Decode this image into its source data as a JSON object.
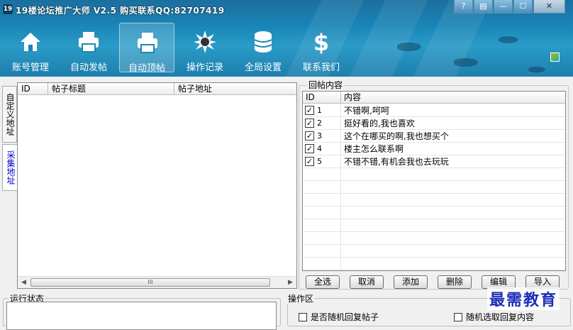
{
  "window": {
    "title": "19楼论坛推广大师 V2.5 购买联系QQ:82707419",
    "logo_glyph": "19"
  },
  "toolbar": {
    "items": [
      {
        "label": "账号管理",
        "icon": "home-icon"
      },
      {
        "label": "自动发帖",
        "icon": "printer-icon"
      },
      {
        "label": "自动顶帖",
        "icon": "printer-icon",
        "active": true
      },
      {
        "label": "操作记录",
        "icon": "starburst-icon"
      },
      {
        "label": "全局设置",
        "icon": "database-icon"
      },
      {
        "label": "联系我们",
        "icon": "dollar-icon"
      }
    ]
  },
  "side_tabs": [
    "自定义地址",
    "采集地址"
  ],
  "post_list": {
    "columns": [
      "ID",
      "帖子标题",
      "帖子地址"
    ],
    "scroll_glyph": "III"
  },
  "reply": {
    "group_label": "回帖内容",
    "columns": [
      "ID",
      "内容"
    ],
    "rows": [
      {
        "id": "1",
        "text": "不错啊,呵呵",
        "checked": true
      },
      {
        "id": "2",
        "text": "挺好看的,我也喜欢",
        "checked": true
      },
      {
        "id": "3",
        "text": "这个在哪买的啊,我也想买个",
        "checked": true
      },
      {
        "id": "4",
        "text": "楼主怎么联系啊",
        "checked": true
      },
      {
        "id": "5",
        "text": "不错不错,有机会我也去玩玩",
        "checked": true
      }
    ],
    "buttons": [
      "全选",
      "取消",
      "添加",
      "删除",
      "编辑",
      "导入"
    ]
  },
  "status": {
    "label": "运行状态"
  },
  "operation": {
    "label": "操作区",
    "options": [
      "是否随机回复帖子",
      "随机选取回复内容"
    ]
  },
  "watermark": "最需教育",
  "colors": {
    "header_blue": "#1a86b8",
    "watermark_blue": "#1e2db8"
  }
}
